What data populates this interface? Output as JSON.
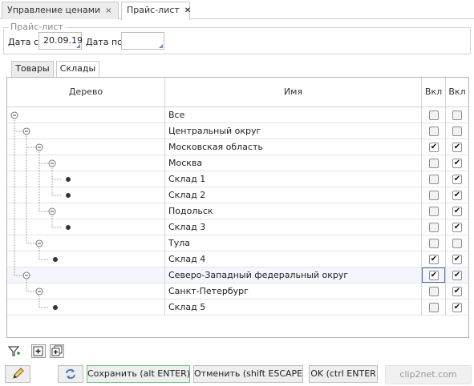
{
  "tabs": [
    {
      "label": "Управление ценами",
      "close": "×"
    },
    {
      "label": "Прайс-лист",
      "close": "✕"
    }
  ],
  "filter": {
    "legend": "Прайс-лист",
    "date_from_label": "Дата с",
    "date_from_value": "20.09.19",
    "date_to_label": "Дата по",
    "date_to_value": ""
  },
  "subtabs": [
    "Товары",
    "Склады"
  ],
  "grid": {
    "headers": {
      "tree": "Дерево",
      "name": "Имя",
      "on1": "Вкл",
      "on2": "Вкл"
    },
    "rows": [
      {
        "name": "Все",
        "c1": false,
        "c2": false
      },
      {
        "name": "Центральный округ",
        "c1": false,
        "c2": false
      },
      {
        "name": "Московская область",
        "c1": true,
        "c2": true
      },
      {
        "name": "Москва",
        "c1": false,
        "c2": true
      },
      {
        "name": "Склад 1",
        "c1": false,
        "c2": true
      },
      {
        "name": "Склад 2",
        "c1": false,
        "c2": true
      },
      {
        "name": "Подольск",
        "c1": false,
        "c2": true
      },
      {
        "name": "Склад 3",
        "c1": false,
        "c2": true
      },
      {
        "name": "Тула",
        "c1": false,
        "c2": false
      },
      {
        "name": "Склад 4",
        "c1": true,
        "c2": true
      },
      {
        "name": "Северо-Западный федеральный округ",
        "c1": true,
        "c2": true
      },
      {
        "name": "Санкт-Петербург",
        "c1": false,
        "c2": true
      },
      {
        "name": "Склад 5",
        "c1": false,
        "c2": true
      }
    ]
  },
  "toolbar_icons": [
    "filter-add-icon",
    "expand-icon",
    "expand-all-icon"
  ],
  "buttons": {
    "save": "Сохранить (alt ENTER)",
    "cancel": "Отменить (shift ESCAPE)",
    "ok": "OK (ctrl ENTER"
  },
  "watermark": "clip2net.com",
  "colors": {
    "save_border": "#6cc27a",
    "selection": "#4a6da7"
  }
}
